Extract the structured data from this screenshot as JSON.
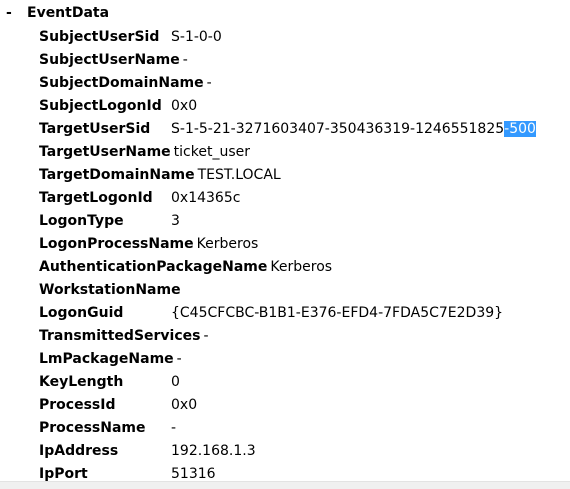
{
  "section": {
    "toggle": "-",
    "title": "EventData"
  },
  "fields": [
    {
      "name": "SubjectUserSid",
      "value": "S-1-0-0",
      "tight": false
    },
    {
      "name": "SubjectUserName",
      "value": "-",
      "tight": true
    },
    {
      "name": "SubjectDomainName",
      "value": "-",
      "tight": true
    },
    {
      "name": "SubjectLogonId",
      "value": "0x0",
      "tight": false
    },
    {
      "name": "TargetUserSid",
      "value": "S-1-5-21-3271603407-350436319-1246551825",
      "value_selected": "-500",
      "tight": false
    },
    {
      "name": "TargetUserName",
      "value": "ticket_user",
      "tight": true
    },
    {
      "name": "TargetDomainName",
      "value": "TEST.LOCAL",
      "tight": true
    },
    {
      "name": "TargetLogonId",
      "value": "0x14365c",
      "tight": false
    },
    {
      "name": "LogonType",
      "value": "3",
      "tight": false
    },
    {
      "name": "LogonProcessName",
      "value": "Kerberos",
      "tight": true
    },
    {
      "name": "AuthenticationPackageName",
      "value": "Kerberos",
      "tight": true
    },
    {
      "name": "WorkstationName",
      "value": "",
      "tight": true
    },
    {
      "name": "LogonGuid",
      "value": "{C45CFCBC-B1B1-E376-EFD4-7FDA5C7E2D39}",
      "tight": false
    },
    {
      "name": "TransmittedServices",
      "value": "-",
      "tight": true
    },
    {
      "name": "LmPackageName",
      "value": "-",
      "tight": true
    },
    {
      "name": "KeyLength",
      "value": "0",
      "tight": false
    },
    {
      "name": "ProcessId",
      "value": "0x0",
      "tight": false
    },
    {
      "name": "ProcessName",
      "value": "-",
      "tight": false
    },
    {
      "name": "IpAddress",
      "value": "192.168.1.3",
      "tight": false
    },
    {
      "name": "IpPort",
      "value": "51316",
      "tight": false
    }
  ],
  "colors": {
    "selection": "#3399ff",
    "selection_text": "#ffffff",
    "text": "#000000",
    "background": "#ffffff"
  }
}
